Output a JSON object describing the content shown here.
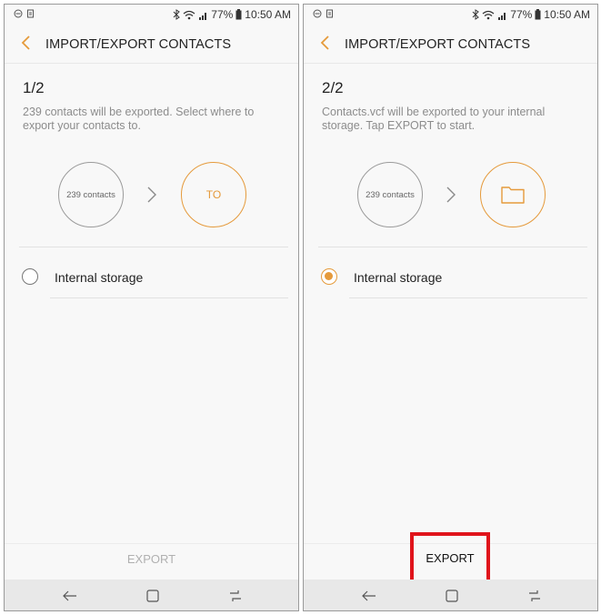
{
  "status_bar": {
    "battery": "77%",
    "time": "10:50 AM"
  },
  "header": {
    "title": "IMPORT/EXPORT CONTACTS"
  },
  "screens": [
    {
      "step": "1/2",
      "description": "239 contacts will be exported. Select where to export your contacts to.",
      "source_circle": "239 contacts",
      "target_circle": "TO",
      "storage_option": "Internal storage",
      "storage_selected": false,
      "export_label": "EXPORT",
      "export_enabled": false
    },
    {
      "step": "2/2",
      "description": "Contacts.vcf will be exported to your internal storage. Tap EXPORT to start.",
      "source_circle": "239 contacts",
      "target_icon": "folder-icon",
      "storage_option": "Internal storage",
      "storage_selected": true,
      "export_label": "EXPORT",
      "export_enabled": true
    }
  ],
  "colors": {
    "accent": "#e59a3b",
    "highlight_box": "#e0141b",
    "nav_bar": "#e8e8e8"
  },
  "icons": [
    "back-arrow-icon",
    "chevron-right-icon",
    "folder-icon",
    "nav-back-icon",
    "nav-home-icon",
    "nav-recent-icon",
    "bluetooth-icon",
    "wifi-icon",
    "signal-icon",
    "battery-icon"
  ]
}
